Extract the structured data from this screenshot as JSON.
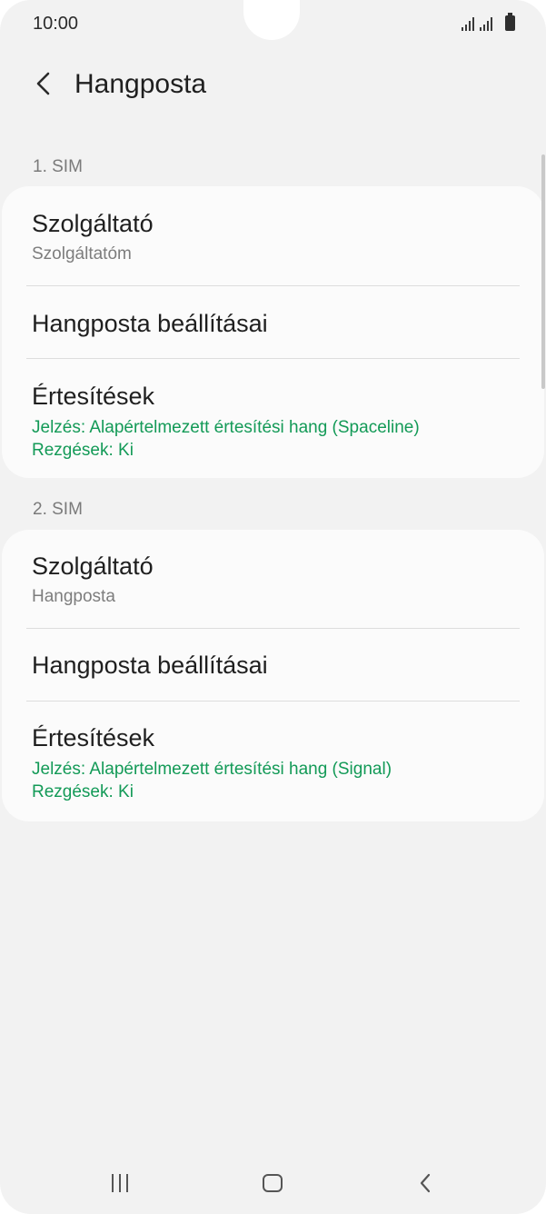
{
  "status_bar": {
    "time": "10:00",
    "icons": [
      "signal-sim1-icon",
      "signal-sim2-icon",
      "battery-icon"
    ]
  },
  "app_bar": {
    "back_icon": "back-arrow-icon",
    "title": "Hangposta"
  },
  "sections": [
    {
      "label": "1. SIM",
      "items": [
        {
          "title": "Szolgáltató",
          "subtitle": "Szolgáltatóm"
        },
        {
          "title": "Hangposta beállításai"
        },
        {
          "title": "Értesítések",
          "detail1": "Jelzés: Alapértelmezett értesítési hang (Spaceline)",
          "detail2": "Rezgések: Ki"
        }
      ]
    },
    {
      "label": "2. SIM",
      "items": [
        {
          "title": "Szolgáltató",
          "subtitle": "Hangposta"
        },
        {
          "title": "Hangposta beállításai"
        },
        {
          "title": "Értesítések",
          "detail1": "Jelzés: Alapértelmezett értesítési hang (Signal)",
          "detail2": "Rezgések: Ki"
        }
      ]
    }
  ],
  "nav_bar": {
    "buttons": [
      "recents-icon",
      "home-icon",
      "back-icon"
    ]
  },
  "colors": {
    "background": "#f2f2f2",
    "card": "#fbfbfb",
    "accent_green": "#139a57",
    "secondary_text": "#7d7d7d"
  }
}
